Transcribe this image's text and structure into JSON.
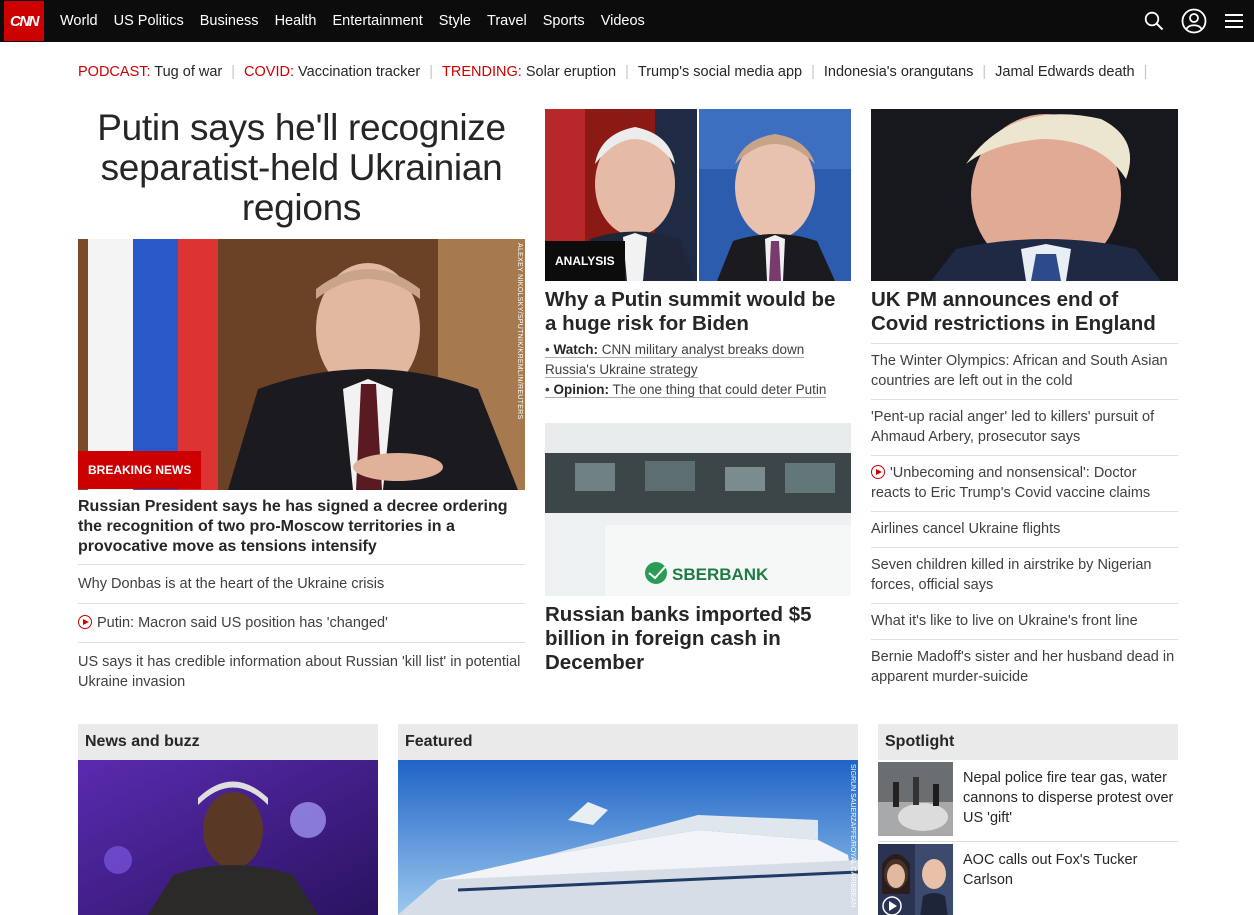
{
  "brand": {
    "logo": "CNN"
  },
  "nav": {
    "links": [
      "World",
      "US Politics",
      "Business",
      "Health",
      "Entertainment",
      "Style",
      "Travel",
      "Sports",
      "Videos"
    ]
  },
  "trending": [
    {
      "kw": "PODCAST:",
      "text": "Tug of war"
    },
    {
      "kw": "COVID:",
      "text": "Vaccination tracker"
    },
    {
      "kw": "TRENDING:",
      "text": "Solar eruption"
    },
    {
      "kw": "",
      "text": "Trump's social media app"
    },
    {
      "kw": "",
      "text": "Indonesia's orangutans"
    },
    {
      "kw": "",
      "text": "Jamal Edwards death"
    }
  ],
  "main": {
    "headline": "Putin says he'll recognize separatist-held Ukrainian regions",
    "hero_credit": "ALEXEY NIKOLSKY/SPUTNIK/KREMLIN/REUTERS",
    "badge": "BREAKING NEWS",
    "lede": "Russian President says he has signed a decree ordering the recognition of two pro-Moscow territories in a provocative move as tensions intensify",
    "related": [
      {
        "text": "Why Donbas is at the heart of the Ukraine crisis",
        "video": false
      },
      {
        "text": "Putin: Macron said US position has 'changed'",
        "video": true
      },
      {
        "text": "US says it has credible information about Russian 'kill list' in potential Ukraine invasion",
        "video": false
      }
    ]
  },
  "middle": {
    "badge": "ANALYSIS",
    "story1": {
      "title": "Why a Putin summit would be a huge risk for Biden",
      "watch_kw": "Watch:",
      "watch_text_1": "CNN military analyst breaks down",
      "watch_text_2": "Russia's Ukraine strategy",
      "opinion_kw": "Opinion:",
      "opinion_text": "The one thing that could deter Putin"
    },
    "sberbank_sign": "SBERBANK",
    "story2": {
      "title": "Russian banks imported $5 billion in foreign cash in December"
    }
  },
  "right": {
    "title": "UK PM announces end of Covid restrictions in England",
    "items": [
      {
        "text": "The Winter Olympics: African and South Asian countries are left out in the cold",
        "video": false
      },
      {
        "text": "'Pent-up racial anger' led to killers' pursuit of Ahmaud Arbery, prosecutor says",
        "video": false
      },
      {
        "text": "'Unbecoming and nonsensical': Doctor reacts to Eric Trump's Covid vaccine claims",
        "video": true
      },
      {
        "text": "Airlines cancel Ukraine flights",
        "video": false
      },
      {
        "text": "Seven children killed in airstrike by Nigerian forces, official says",
        "video": false
      },
      {
        "text": "What it's like to live on Ukraine's front line",
        "video": false
      },
      {
        "text": "Bernie Madoff's sister and her husband dead in apparent murder-suicide",
        "video": false
      }
    ]
  },
  "sections": {
    "news_buzz": "News and buzz",
    "featured": "Featured",
    "featured_credit": "SIGRUN SAUERZAPFE/ROYAL CARIBBEAN",
    "spotlight": "Spotlight",
    "spotlight_items": [
      "Nepal police fire tear gas, water cannons to disperse protest over US 'gift'",
      "AOC calls out Fox's Tucker Carlson"
    ]
  },
  "colors": {
    "accent": "#cc0000",
    "nav_bg": "#0c0c0c",
    "section_bg": "#eaeaea"
  },
  "icons": [
    "search-icon",
    "account-icon",
    "menu-icon",
    "play-icon"
  ]
}
